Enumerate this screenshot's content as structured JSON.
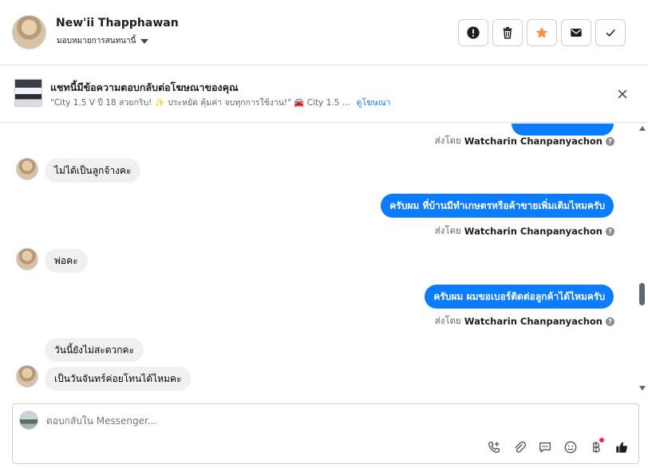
{
  "header": {
    "contact_name": "New'ii Thapphawan",
    "assign_label": "มอบหมายการสนทนานี้",
    "actions": [
      {
        "name": "spam",
        "icon": "alert-circle-icon"
      },
      {
        "name": "delete",
        "icon": "trash-icon"
      },
      {
        "name": "star",
        "icon": "star-icon"
      },
      {
        "name": "mark-unread",
        "icon": "envelope-icon"
      },
      {
        "name": "done",
        "icon": "checkmark-icon"
      }
    ]
  },
  "ad_banner": {
    "title": "แชทนี้มีข้อความตอบกลับต่อโฆษณาของคุณ",
    "subtitle": "\"City 1.5 V ปี 18 สวยกริบ! ✨ ประหยัด คุ้มค่า จบทุกการใช้งาน!\" 🚘 City 1.5 ...",
    "link": "ดูโฆษณา"
  },
  "messages": [
    {
      "direction": "out",
      "text": "",
      "sent_by_label": "ส่งโดย",
      "sender": "Watcharin Chanpanyachon"
    },
    {
      "direction": "in",
      "text": "ไม่ได้เป็นลูกจ้างคะ"
    },
    {
      "direction": "out",
      "text": "ครับผม ที่บ้านมีทำเกษตรหรือค้าขายเพิ่มเติมไหมครับ",
      "sent_by_label": "ส่งโดย",
      "sender": "Watcharin Chanpanyachon"
    },
    {
      "direction": "in",
      "text": "พ่อคะ"
    },
    {
      "direction": "out",
      "text": "ครับผม ผมขอเบอร์ติดต่อลูกค้าได้ไหมครับ",
      "sent_by_label": "ส่งโดย",
      "sender": "Watcharin Chanpanyachon"
    },
    {
      "direction": "in",
      "text": "วันนี้ยังไม่สะดวกคะ"
    },
    {
      "direction": "in",
      "text": "เป็นวันจันทร์ค่อยโทนได้ไหมคะ"
    }
  ],
  "composer": {
    "placeholder": "ตอบกลับใน Messenger...",
    "tools": [
      "phone-plus-icon",
      "paperclip-icon",
      "saved-reply-icon",
      "emoji-icon",
      "baht-icon",
      "thumbs-up-icon"
    ]
  },
  "colors": {
    "accent": "#0a7cff",
    "incoming_bubble": "#f0f0f0",
    "star": "#f7923b",
    "notification_dot": "#f02849"
  }
}
